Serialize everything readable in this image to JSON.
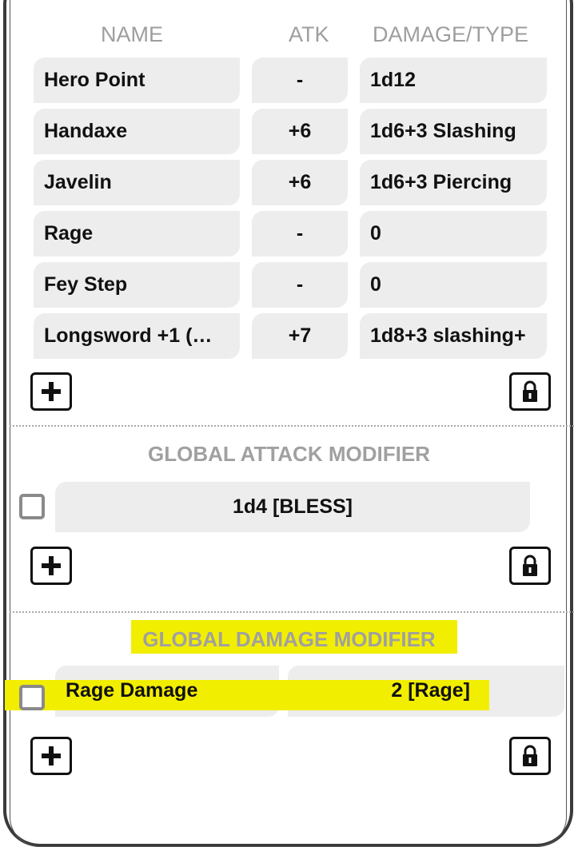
{
  "table": {
    "headers": {
      "name": "NAME",
      "atk": "ATK",
      "damage": "DAMAGE/TYPE"
    },
    "rows": [
      {
        "name": "Hero Point",
        "atk": "-",
        "damage": "1d12"
      },
      {
        "name": "Handaxe",
        "atk": "+6",
        "damage": "1d6+3 Slashing"
      },
      {
        "name": "Javelin",
        "atk": "+6",
        "damage": "1d6+3 Piercing"
      },
      {
        "name": "Rage",
        "atk": "-",
        "damage": "0"
      },
      {
        "name": "Fey Step",
        "atk": "-",
        "damage": "0"
      },
      {
        "name": "Longsword +1 (…",
        "atk": "+7",
        "damage": "1d8+3 slashing+"
      }
    ]
  },
  "global_attack": {
    "title": "GLOBAL ATTACK MODIFIER",
    "items": [
      {
        "value": "1d4 [BLESS]",
        "checked": false
      }
    ]
  },
  "global_damage": {
    "title": "GLOBAL DAMAGE MODIFIER",
    "items": [
      {
        "name": "Rage Damage",
        "value": "2 [Rage]",
        "checked": false
      }
    ]
  },
  "icons": {
    "add": "plus-icon",
    "lock": "lock-icon"
  },
  "colors": {
    "highlight": "#f2ee00",
    "cell_bg": "#ededed",
    "header_text": "#9e9e9e"
  }
}
